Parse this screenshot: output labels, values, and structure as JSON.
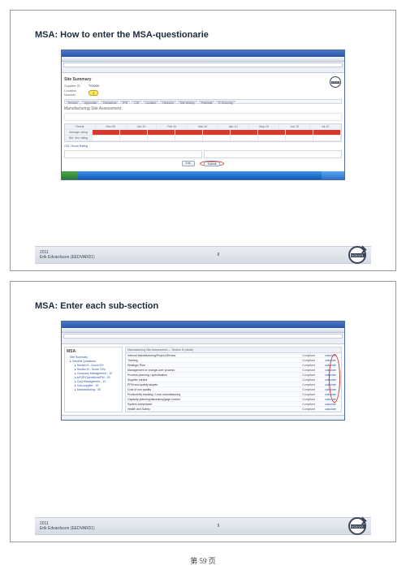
{
  "page_number_label": "第 59 页",
  "logo_text": "VOLVO",
  "slide1": {
    "title": "MSA: How to enter the MSA-questionarie",
    "section": "Site Summary",
    "field1_label": "Supplier ID",
    "field1_value": "700000",
    "field2_label": "Location Number",
    "field2_badge": "1",
    "tabs": [
      "Review",
      "Approvals",
      "Deviations",
      "IPR",
      "CSI",
      "Location",
      "Decision",
      "Site History",
      "Potential",
      "E-Sourcing"
    ],
    "subtitle": "Manufacturing Site Assessment",
    "months": [
      "Result",
      "Dec-09",
      "Jan-10",
      "Feb-10",
      "Mar-10",
      "Apr-10",
      "May-10",
      "Jun-10",
      "Jul-10"
    ],
    "row_label1": "Average rating",
    "row1_vals": [
      "",
      "",
      "",
      "",
      "",
      "",
      "",
      "",
      ""
    ],
    "row_label2": "Std. dev. rating",
    "row2_vals": [
      "",
      "",
      "",
      "",
      "",
      "",
      "",
      "",
      ""
    ],
    "blue_label": "CSI / Score Rating",
    "btn_edit": "Edit",
    "btn_submit": "Submit",
    "footer_year": "2011",
    "footer_author": "Erik Edvardsson (EEDVARD1)",
    "footer_page": "8"
  },
  "slide2": {
    "title": "MSA: Enter each sub-section",
    "nav_head": "MSA",
    "nav_items": [
      "Site Summary",
      "General Questions",
      "Section A - Score 5%",
      "Section B - Score 10%",
      "Company Management - 10",
      "APQP/Operations/PM - 20",
      "Cost Management - 10",
      "Sub-supplier - 10",
      "Manufacturing - 30"
    ],
    "list_header": "Manufacturing Site Assessment — Section B (detail)",
    "items": [
      {
        "a": "Internal Manufacturing/Project-Review",
        "b": "Compliant",
        "c": "calculate"
      },
      {
        "a": "Training",
        "b": "Compliant",
        "c": "calculate"
      },
      {
        "a": "Strategic Plan",
        "b": "Compliant",
        "c": "calculate"
      },
      {
        "a": "Management of change-over process",
        "b": "Compliant",
        "c": "calculate"
      },
      {
        "a": "Process planning / specification",
        "b": "Compliant",
        "c": "calculate"
      },
      {
        "a": "Supplier control",
        "b": "Compliant",
        "c": "calculate"
      },
      {
        "a": "PPM and quality targets",
        "b": "Compliant",
        "c": "calculate"
      },
      {
        "a": "Cost of non quality",
        "b": "Compliant",
        "c": "calculate"
      },
      {
        "a": "Productivity tracking / Lean manufacturing",
        "b": "Compliant",
        "c": "calculate"
      },
      {
        "a": "Capacity planning/laboratory/gage control",
        "b": "Compliant",
        "c": "calculate"
      },
      {
        "a": "System compliance",
        "b": "Compliant",
        "c": "calculate"
      },
      {
        "a": "Health and Safety",
        "b": "Compliant",
        "c": "calculate"
      }
    ],
    "footer_year": "2011",
    "footer_author": "Erik Edvardsson (EEDVARD1)",
    "footer_page": "9"
  }
}
